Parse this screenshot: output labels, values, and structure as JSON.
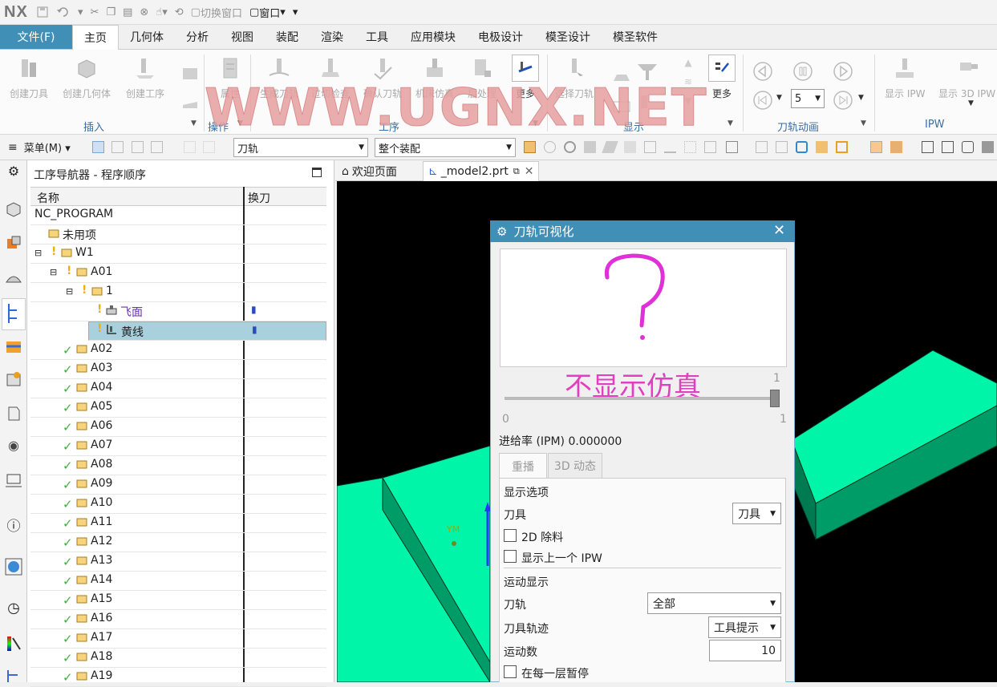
{
  "app": {
    "logo": "NX"
  },
  "quick_access": {
    "switch_window": "切换窗口",
    "window": "窗口"
  },
  "ribbon_tabs": [
    {
      "label": "文件(F)"
    },
    {
      "label": "主页"
    },
    {
      "label": "几何体"
    },
    {
      "label": "分析"
    },
    {
      "label": "视图"
    },
    {
      "label": "装配"
    },
    {
      "label": "渲染"
    },
    {
      "label": "工具"
    },
    {
      "label": "应用模块"
    },
    {
      "label": "电极设计"
    },
    {
      "label": "模圣设计"
    },
    {
      "label": "模圣软件"
    }
  ],
  "ribbon": {
    "buttons": {
      "create_tool": "创建刀具",
      "create_geometry": "创建几何体",
      "create_operation": "创建工序",
      "properties": "属性",
      "generate_path": "生成刀轨",
      "gouge_check": "过切检查",
      "verify_path": "确认刀轨",
      "machine_sim": "机床仿真",
      "postprocess": "后处理",
      "more1": "更多",
      "select_path": "选择刀轨",
      "more2": "更多",
      "show_ipw": "显示 IPW",
      "show_3d_ipw": "显示 3D IPW"
    },
    "groups": {
      "insert": "插入",
      "operation": "操作",
      "process": "工序",
      "display": "显示",
      "path_animation": "刀轨动画",
      "ipw": "IPW"
    },
    "anim_speed": "5",
    "watermark": "WWW.UGNX.NET"
  },
  "toolbar2": {
    "menu": "菜单(M)",
    "filter1": "刀轨",
    "filter2": "整个装配"
  },
  "navigator": {
    "title": "工序导航器 - 程序顺序",
    "col_name": "名称",
    "col_tool_change": "换刀",
    "root": "NC_PROGRAM",
    "unused": "未用项",
    "w1": "W1",
    "a01": "A01",
    "group1": "1",
    "op_face": "飞面",
    "op_line": "黄线",
    "programs": [
      "A02",
      "A03",
      "A04",
      "A05",
      "A06",
      "A07",
      "A08",
      "A09",
      "A10",
      "A11",
      "A12",
      "A13",
      "A14",
      "A15",
      "A16",
      "A17",
      "A18",
      "A19"
    ]
  },
  "view_tabs": {
    "welcome": "欢迎页面",
    "model": "_model2.prt"
  },
  "viewport": {
    "axis_label": "YM",
    "model_color": "#00f5a8"
  },
  "dialog": {
    "title": "刀轨可视化",
    "annotation_text": "不显示仿真",
    "slider_max_top": "1",
    "slider_min": "0",
    "slider_max": "1",
    "slider_level": 1.0,
    "feedrate": "进给率 (IPM) 0.000000",
    "tab_replay": "重播",
    "tab_3d": "3D 动态",
    "display_options": "显示选项",
    "tool_label": "刀具",
    "tool_value": "刀具",
    "cb_2d": "2D 除料",
    "cb_prev_ipw": "显示上一个 IPW",
    "motion_display": "运动显示",
    "path_label": "刀轨",
    "path_value": "全部",
    "trace_label": "刀具轨迹",
    "trace_value": "工具提示",
    "motion_count_label": "运动数",
    "motion_count_value": "10",
    "cb_pause": "在每一层暂停"
  }
}
